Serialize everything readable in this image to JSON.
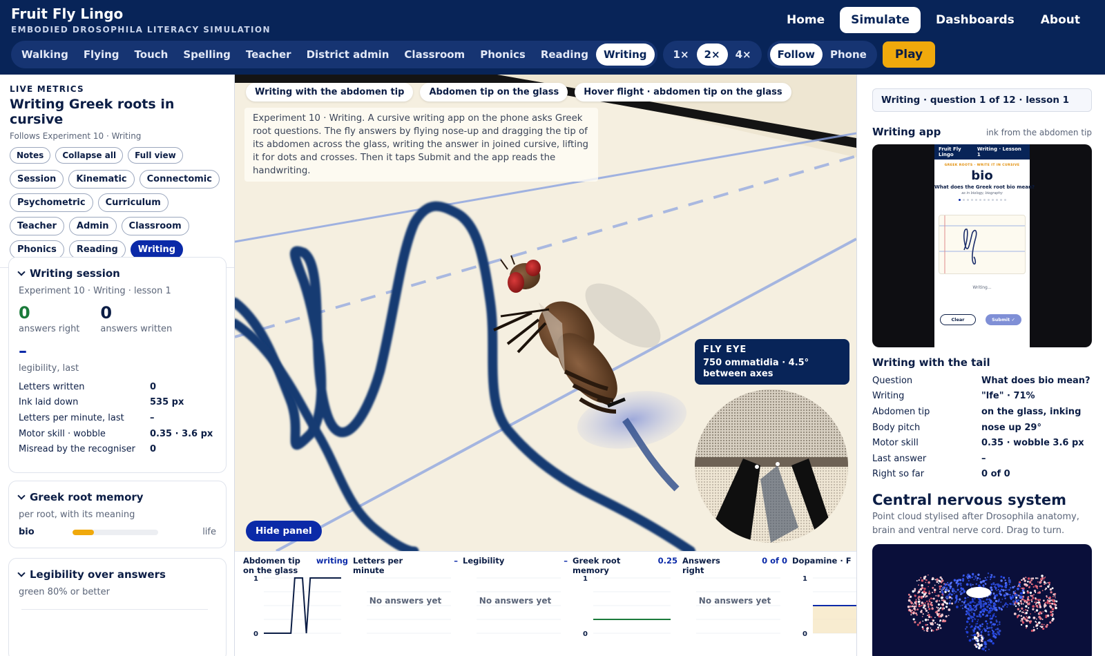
{
  "app": {
    "title": "Fruit Fly Lingo",
    "subtitle": "EMBODIED DROSOPHILA LITERACY SIMULATION"
  },
  "topnav": [
    {
      "label": "Home",
      "active": false
    },
    {
      "label": "Simulate",
      "active": true
    },
    {
      "label": "Dashboards",
      "active": false
    },
    {
      "label": "About",
      "active": false
    }
  ],
  "modes": [
    {
      "label": "Walking",
      "active": false
    },
    {
      "label": "Flying",
      "active": false
    },
    {
      "label": "Touch",
      "active": false
    },
    {
      "label": "Spelling",
      "active": false
    },
    {
      "label": "Teacher",
      "active": false
    },
    {
      "label": "District admin",
      "active": false
    },
    {
      "label": "Classroom",
      "active": false
    },
    {
      "label": "Phonics",
      "active": false
    },
    {
      "label": "Reading",
      "active": false
    },
    {
      "label": "Writing",
      "active": true
    }
  ],
  "speeds": [
    {
      "label": "1×",
      "active": false
    },
    {
      "label": "2×",
      "active": true
    },
    {
      "label": "4×",
      "active": false
    }
  ],
  "camera": [
    {
      "label": "Follow",
      "active": true
    },
    {
      "label": "Phone",
      "active": false
    }
  ],
  "play_label": "Play",
  "left": {
    "live_label": "LIVE METRICS",
    "title": "Writing Greek roots in cursive",
    "subtitle": "Follows Experiment 10 · Writing",
    "view_chips": [
      "Notes",
      "Collapse all",
      "Full view"
    ],
    "section_chips": [
      {
        "label": "Session",
        "active": false
      },
      {
        "label": "Kinematic",
        "active": false
      },
      {
        "label": "Connectomic",
        "active": false
      },
      {
        "label": "Psychometric",
        "active": false
      },
      {
        "label": "Curriculum",
        "active": false
      },
      {
        "label": "Teacher",
        "active": false
      },
      {
        "label": "Admin",
        "active": false
      },
      {
        "label": "Classroom",
        "active": false
      },
      {
        "label": "Phonics",
        "active": false
      },
      {
        "label": "Reading",
        "active": false
      },
      {
        "label": "Writing",
        "active": true
      }
    ],
    "session": {
      "title": "Writing session",
      "sub": "Experiment 10 · Writing · lesson 1",
      "answers_right": "0",
      "answers_right_label": "answers right",
      "answers_written": "0",
      "answers_written_label": "answers written",
      "legibility": "–",
      "legibility_label": "legibility, last",
      "rows": [
        {
          "k": "Letters written",
          "v": "0"
        },
        {
          "k": "Ink laid down",
          "v": "535 px"
        },
        {
          "k": "Letters per minute, last",
          "v": "–"
        },
        {
          "k": "Motor skill · wobble",
          "v": "0.35 · 3.6 px"
        },
        {
          "k": "Misread by the recogniser",
          "v": "0"
        }
      ]
    },
    "roots": {
      "title": "Greek root memory",
      "sub": "per root, with its meaning",
      "items": [
        {
          "name": "bio",
          "meaning": "life",
          "level": 0.25
        }
      ]
    },
    "legibility": {
      "title": "Legibility over answers",
      "sub": "green 80% or better"
    }
  },
  "viewport": {
    "chips": [
      "Writing with the abdomen tip",
      "Abdomen tip on the glass",
      "Hover flight · abdomen tip on the glass"
    ],
    "description": "Experiment 10 · Writing. A cursive writing app on the phone asks Greek root questions. The fly answers by flying nose-up and dragging the tip of its abdomen across the glass, writing the answer in joined cursive, lifting it for dots and crosses. Then it taps Submit and the app reads the handwriting.",
    "hide_panel_label": "Hide panel",
    "fly_eye": {
      "title": "FLY EYE",
      "line1": "750 ommatidia · 4.5°",
      "line2": "between axes"
    }
  },
  "minicharts": [
    {
      "title": "Abdomen tip on the glass",
      "value": "writing",
      "empty": "",
      "y_top": "1",
      "y_bottom": "0",
      "series": [
        0,
        0,
        0,
        0,
        0,
        0,
        0,
        0,
        1,
        1,
        1,
        0,
        1,
        1,
        1,
        1,
        1,
        1,
        1,
        1,
        1
      ],
      "color": "#0b1d45"
    },
    {
      "title": "Letters per minute",
      "value": "–",
      "empty": "No answers yet"
    },
    {
      "title": "Legibility",
      "value": "–",
      "empty": "No answers yet"
    },
    {
      "title": "Greek root memory",
      "value": "0.25",
      "empty": "",
      "y_top": "1",
      "y_bottom": "0",
      "series": [
        0.25,
        0.25,
        0.25,
        0.25,
        0.25,
        0.25,
        0.25,
        0.25,
        0.25,
        0.25,
        0.25
      ],
      "color": "#1a7a3a"
    },
    {
      "title": "Answers right",
      "value": "0 of 0",
      "empty": "No answers yet"
    },
    {
      "title": "Dopamine · F",
      "value": "",
      "empty": "",
      "y_top": "1",
      "y_bottom": "0",
      "series": [
        0.5,
        0.5,
        0.5,
        0.5
      ],
      "color": "#0b2aa8"
    }
  ],
  "right": {
    "question_banner": "Writing · question 1 of 12 · lesson 1",
    "writing_app_title": "Writing app",
    "writing_app_note": "ink from the abdomen tip",
    "phone": {
      "brand": "Fruit Fly Lingo",
      "lesson": "Writing · Lesson 1",
      "tag": "GREEK ROOTS · WRITE IT IN CURSIVE",
      "word": "bio",
      "question": "What does the Greek root bio mean?",
      "example": "as in biology, biography",
      "status": "Writing...",
      "clear": "Clear",
      "submit": "Submit ✓"
    },
    "tail_title": "Writing with the tail",
    "tail_rows": [
      {
        "k": "Question",
        "v": "What does bio mean?"
      },
      {
        "k": "Writing",
        "v": "\"lfe\" · 71%"
      },
      {
        "k": "Abdomen tip",
        "v": "on the glass, inking"
      },
      {
        "k": "Body pitch",
        "v": "nose up 29°"
      },
      {
        "k": "Motor skill",
        "v": "0.35 · wobble 3.6 px"
      },
      {
        "k": "Last answer",
        "v": "–"
      },
      {
        "k": "Right so far",
        "v": "0 of 0"
      }
    ],
    "cns_title": "Central nervous system",
    "cns_desc": "Point cloud stylised after Drosophila anatomy, brain and ventral nerve cord. Drag to turn."
  }
}
